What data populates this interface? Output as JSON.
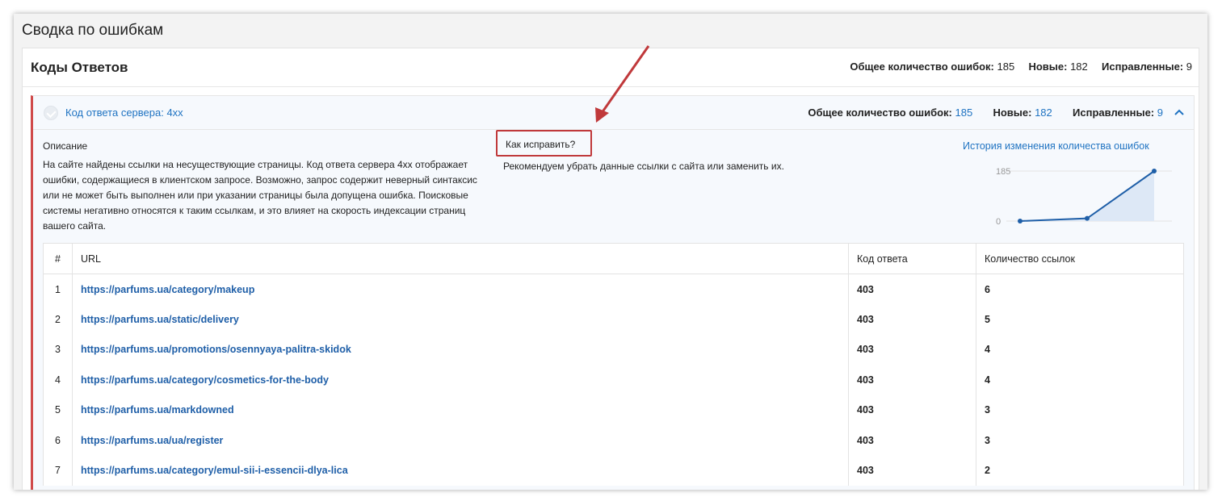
{
  "page": {
    "title": "Сводка по ошибкам"
  },
  "card": {
    "title": "Коды Ответов",
    "stats": {
      "total_label": "Общее количество ошибок:",
      "total": "185",
      "new_label": "Новые:",
      "new": "182",
      "fixed_label": "Исправленные:",
      "fixed": "9"
    }
  },
  "error_group": {
    "title": "Код ответа сервера: 4xx",
    "stats": {
      "total_label": "Общее количество ошибок:",
      "total": "185",
      "new_label": "Новые:",
      "new": "182",
      "fixed_label": "Исправленные:",
      "fixed": "9"
    },
    "description_label": "Описание",
    "description": "На сайте найдены ссылки на несуществующие страницы. Код ответа сервера 4xx отображает ошибки, содержащиеся в клиентском запросе. Возможно, запрос содержит неверный синтаксис или не может быть выполнен или при указании страницы была допущена ошибка. Поисковые системы негативно относятся к таким ссылкам, и это влияет на скорость индексации страниц вашего сайта.",
    "fix_label": "Как исправить?",
    "fix_text": "Рекомендуем убрать данные ссылки с сайта или заменить их.",
    "history_title": "История изменения количества ошибок"
  },
  "chart_data": {
    "type": "area",
    "y_ticks": [
      "185",
      "0"
    ],
    "ylim": [
      0,
      185
    ],
    "values": [
      0,
      10,
      185
    ],
    "color": "#1f5fa8",
    "fill": "#dde8f6"
  },
  "table": {
    "headers": {
      "num": "#",
      "url": "URL",
      "code": "Код ответа",
      "count": "Количество ссылок"
    },
    "rows": [
      {
        "num": "1",
        "url": "https://parfums.ua/category/makeup",
        "code": "403",
        "count": "6"
      },
      {
        "num": "2",
        "url": "https://parfums.ua/static/delivery",
        "code": "403",
        "count": "5"
      },
      {
        "num": "3",
        "url": "https://parfums.ua/promotions/osennyaya-palitra-skidok",
        "code": "403",
        "count": "4"
      },
      {
        "num": "4",
        "url": "https://parfums.ua/category/cosmetics-for-the-body",
        "code": "403",
        "count": "4"
      },
      {
        "num": "5",
        "url": "https://parfums.ua/markdowned",
        "code": "403",
        "count": "3"
      },
      {
        "num": "6",
        "url": "https://parfums.ua/ua/register",
        "code": "403",
        "count": "3"
      },
      {
        "num": "7",
        "url": "https://parfums.ua/category/emul-sii-i-essencii-dlya-lica",
        "code": "403",
        "count": "2"
      }
    ]
  },
  "colors": {
    "accent": "#1f73c2",
    "error_border": "#d04a4a",
    "annotation": "#c0393b"
  }
}
